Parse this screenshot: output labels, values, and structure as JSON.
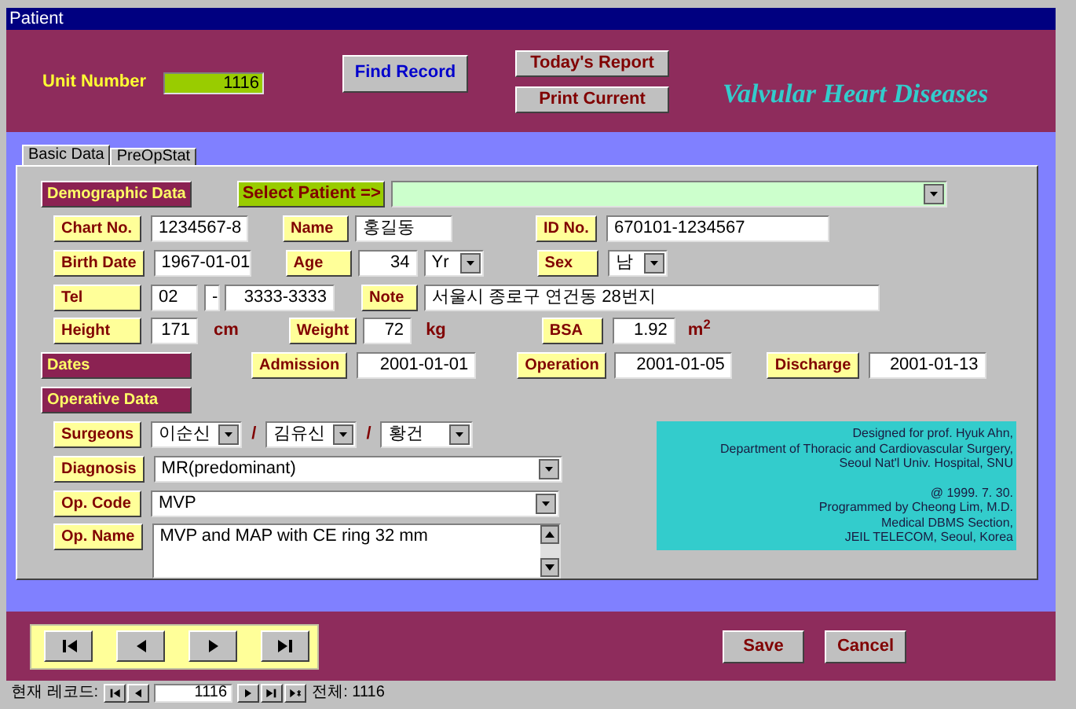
{
  "window": {
    "title": "Patient"
  },
  "header": {
    "unit_label": "Unit Number",
    "unit_value": "1116",
    "find_button": "Find Record",
    "report_button": "Today's Report",
    "print_button": "Print Current",
    "app_title": "Valvular Heart Diseases"
  },
  "tabs": [
    {
      "label": "Basic Data",
      "selected": true
    },
    {
      "label": "PreOpStat",
      "selected": false
    }
  ],
  "demographic": {
    "heading": "Demographic Data",
    "select_button": "Select Patient =>",
    "chart_no": {
      "label": "Chart No.",
      "value": "1234567-8"
    },
    "name": {
      "label": "Name",
      "value": "홍길동"
    },
    "id_no": {
      "label": "ID No.",
      "value": "670101-1234567"
    },
    "birth_date": {
      "label": "Birth Date",
      "value": "1967-01-01"
    },
    "age": {
      "label": "Age",
      "value": "34",
      "unit": "Yr"
    },
    "sex": {
      "label": "Sex",
      "value": "남"
    },
    "tel": {
      "label": "Tel",
      "area": "02",
      "dash": "-",
      "number": "3333-3333"
    },
    "note": {
      "label": "Note",
      "value": "서울시 종로구 연건동 28번지"
    },
    "height": {
      "label": "Height",
      "value": "171",
      "unit": "cm"
    },
    "weight": {
      "label": "Weight",
      "value": "72",
      "unit": "kg"
    },
    "bsa": {
      "label": "BSA",
      "value": "1.92",
      "unit": "m$^{2}$"
    }
  },
  "dates": {
    "heading": "Dates",
    "admission": {
      "label": "Admission",
      "value": "2001-01-01"
    },
    "operation": {
      "label": "Operation",
      "value": "2001-01-05"
    },
    "discharge": {
      "label": "Discharge",
      "value": "2001-01-13"
    }
  },
  "operative": {
    "heading": "Operative Data",
    "surgeons": {
      "label": "Surgeons",
      "values": [
        "이순신",
        "김유신",
        "황건"
      ],
      "separators": [
        "/",
        "/"
      ]
    },
    "diagnosis": {
      "label": "Diagnosis",
      "value": "MR(predominant)"
    },
    "op_code": {
      "label": "Op. Code",
      "value": "MVP"
    },
    "op_name": {
      "label": "Op. Name",
      "value": "MVP and MAP with CE ring 32 mm"
    }
  },
  "credits": [
    {
      "lines": [
        "Designed for prof. Hyuk Ahn,",
        "Department of Thoracic and Cardiovascular Surgery,",
        "Seoul Nat'l Univ. Hospital, SNU"
      ]
    },
    {
      "lines": [
        "@ 1999. 7. 30.",
        "Programmed by Cheong Lim, M.D.",
        "Medical DBMS Section,",
        "JEIL TELECOM, Seoul, Korea"
      ]
    }
  ],
  "nav_buttons": [
    {
      "kind": "first"
    },
    {
      "kind": "previous"
    },
    {
      "kind": "next"
    },
    {
      "kind": "last"
    }
  ],
  "save_button": "Save",
  "cancel_button": "Cancel",
  "status_bar": {
    "record_label": "현재 레코드:",
    "nav_before": [
      {
        "kind": "first"
      },
      {
        "kind": "previous"
      }
    ],
    "record_value": "1116",
    "nav_after": [
      {
        "kind": "next"
      },
      {
        "kind": "last"
      },
      {
        "kind": "new"
      }
    ],
    "total": "전체: 1116"
  }
}
